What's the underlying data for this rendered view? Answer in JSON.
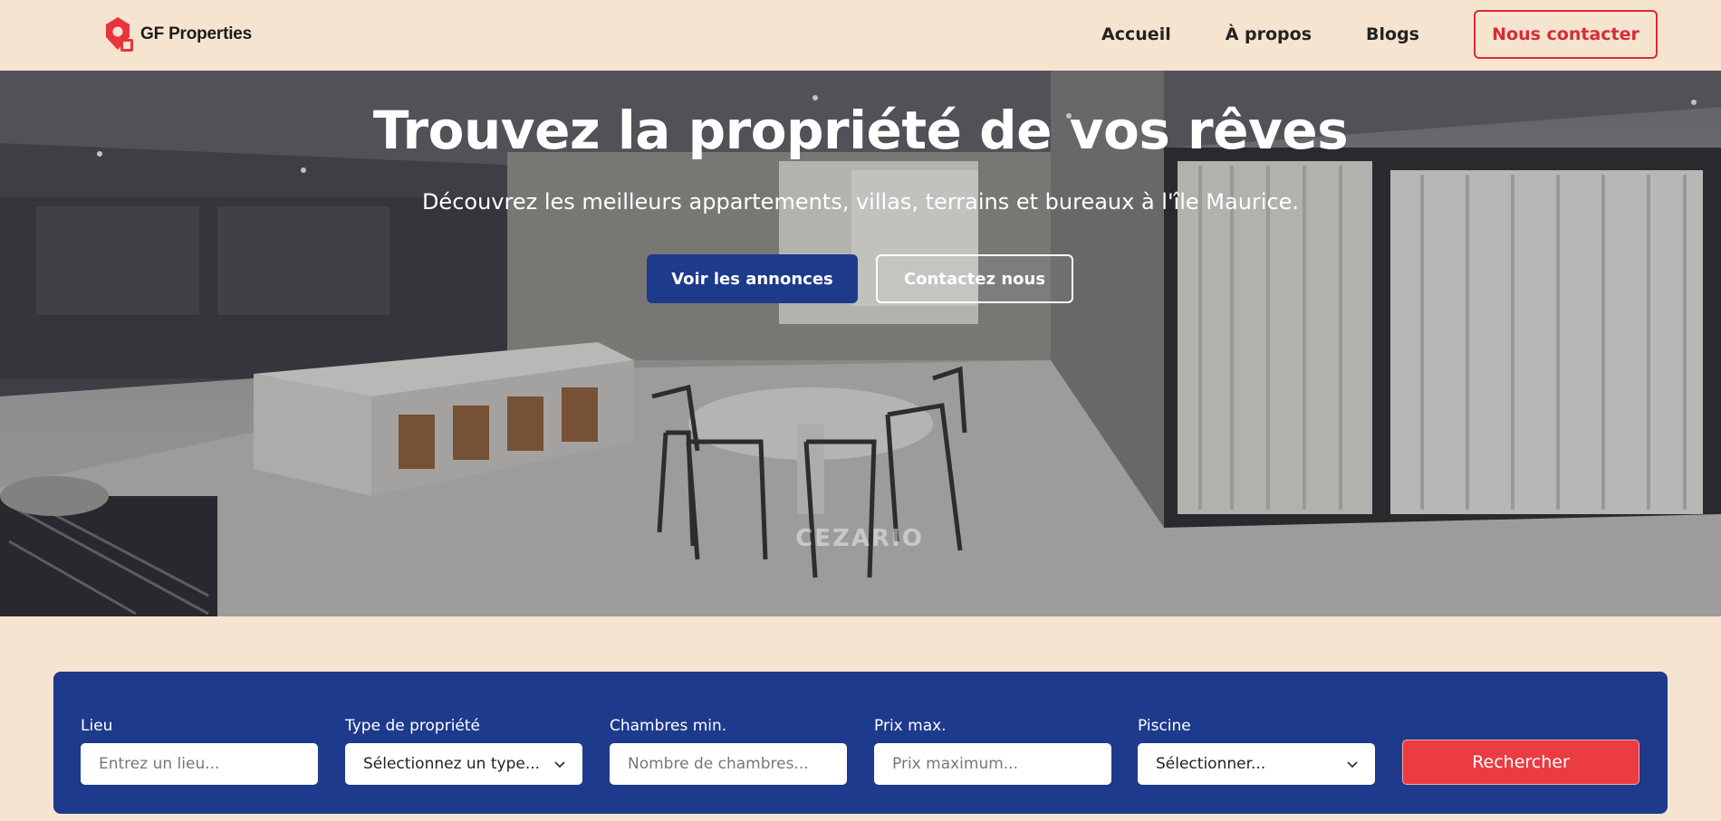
{
  "header": {
    "brand": "GF Properties",
    "nav": [
      {
        "label": "Accueil"
      },
      {
        "label": "À propos"
      },
      {
        "label": "Blogs"
      }
    ],
    "contact_label": "Nous contacter"
  },
  "hero": {
    "title": "Trouvez la propriété de vos rêves",
    "subtitle": "Découvrez les meilleurs appartements, villas, terrains et bureaux à l'île Maurice.",
    "primary_button": "Voir les annonces",
    "secondary_button": "Contactez nous",
    "watermark": "CEZARIO"
  },
  "search": {
    "fields": [
      {
        "label": "Lieu",
        "placeholder": "Entrez un lieu..."
      },
      {
        "label": "Type de propriété",
        "value": "Sélectionnez un type..."
      },
      {
        "label": "Chambres min.",
        "placeholder": "Nombre de chambres..."
      },
      {
        "label": "Prix max.",
        "placeholder": "Prix maximum..."
      },
      {
        "label": "Piscine",
        "value": "Sélectionner..."
      }
    ],
    "button": "Rechercher"
  },
  "colors": {
    "background": "#f5e4d0",
    "brand_blue": "#1d3a8c",
    "brand_red": "#d92b35",
    "search_red": "#ea3c41"
  }
}
